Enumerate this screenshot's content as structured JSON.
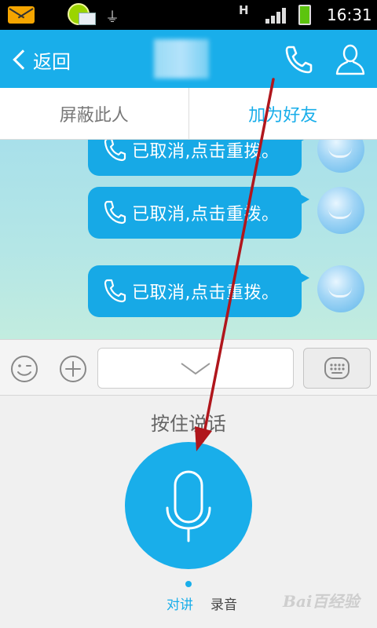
{
  "status_bar": {
    "time": "16:31",
    "network": "H"
  },
  "header": {
    "back_label": "返回",
    "icons": {
      "call": "phone-icon",
      "profile": "user-icon"
    }
  },
  "actions": {
    "block_label": "屏蔽此人",
    "add_friend_label": "加为好友"
  },
  "messages": [
    {
      "text": "已取消,点击重拨。",
      "icon": "phone-icon"
    },
    {
      "text": "已取消,点击重拨。",
      "icon": "phone-icon"
    },
    {
      "text": "已取消,点击重拨。",
      "icon": "phone-icon"
    }
  ],
  "input_bar": {
    "icons": [
      "smiley-icon",
      "plus-icon",
      "chevron-down-icon",
      "keyboard-icon"
    ]
  },
  "voice": {
    "hold_to_talk_label": "按住说话",
    "tabs": [
      {
        "label": "对讲",
        "active": true
      },
      {
        "label": "录音",
        "active": false
      }
    ]
  },
  "watermark": "Bai百经验",
  "colors": {
    "accent": "#19aeea",
    "annotation_arrow": "#b0161c"
  }
}
